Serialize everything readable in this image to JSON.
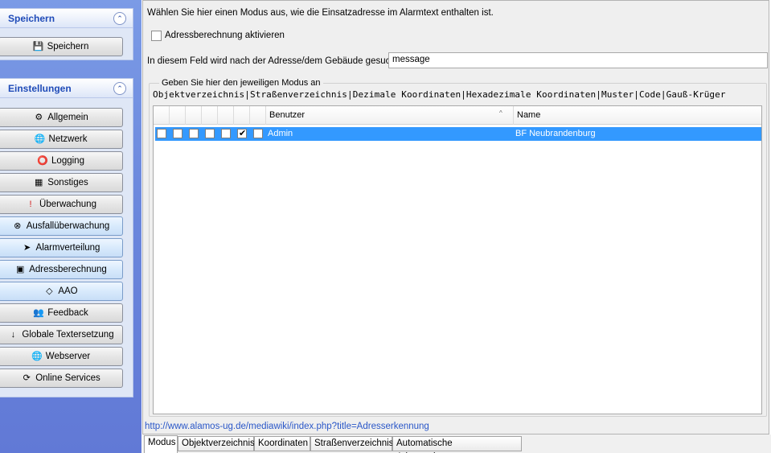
{
  "left": {
    "panel_save": {
      "title": "Speichern",
      "collapse": "⌃",
      "buttons": [
        {
          "label": "Speichern",
          "icon": "save-icon"
        }
      ]
    },
    "panel_settings": {
      "title": "Einstellungen",
      "collapse": "⌃",
      "buttons": [
        {
          "label": "Allgemein",
          "icon": "gear-icon"
        },
        {
          "label": "Netzwerk",
          "icon": "globe-icon"
        },
        {
          "label": "Logging",
          "icon": "logging-icon"
        },
        {
          "label": "Sonstiges",
          "icon": "table-icon"
        },
        {
          "label": "Überwachung",
          "icon": "warning-icon"
        },
        {
          "label": "Ausfallüberwachung",
          "icon": "failure-icon"
        },
        {
          "label": "Alarmverteilung",
          "icon": "distribution-icon"
        },
        {
          "label": "Adressberechnung",
          "icon": "address-icon"
        },
        {
          "label": "AAO",
          "icon": "aao-icon"
        },
        {
          "label": "Feedback",
          "icon": "people-icon"
        },
        {
          "label": "Globale Textersetzung",
          "icon": "sort-az-icon"
        },
        {
          "label": "Webserver",
          "icon": "globe-icon"
        },
        {
          "label": "Online Services",
          "icon": "online-icon"
        }
      ]
    }
  },
  "main": {
    "intro": "Wählen Sie hier einen Modus aus, wie die Einsatzadresse im Alarmtext enthalten ist.",
    "checkbox_label": "Adressberechnung aktivieren",
    "search_label": "In diesem Feld wird nach der Adresse/dem Gebäude gesucht:",
    "search_value": "message",
    "group_title": "Geben Sie hier den jeweiligen Modus an",
    "modes_line": "Objektverzeichnis|Straßenverzeichnis|Dezimale Koordinaten|Hexadezimale Koordinaten|Muster|Code|Gauß-Krüger",
    "table": {
      "columns": [
        "Benutzer",
        "Name"
      ],
      "sort_indicator": "^",
      "rows": [
        {
          "benutzer": "Admin",
          "name": "BF Neubrandenburg",
          "checks": [
            false,
            false,
            false,
            false,
            false,
            true,
            false
          ]
        }
      ]
    },
    "link": "http://www.alamos-ug.de/mediawiki/index.php?title=Adresserkennung"
  },
  "tabs": [
    "Modus",
    "Objektverzeichnis",
    "Koordinaten",
    "Straßenverzeichnis",
    "Automatische Adresserkennung"
  ],
  "colors": {
    "selection": "#3399ff",
    "nav_gradient": "#6a86dc"
  }
}
